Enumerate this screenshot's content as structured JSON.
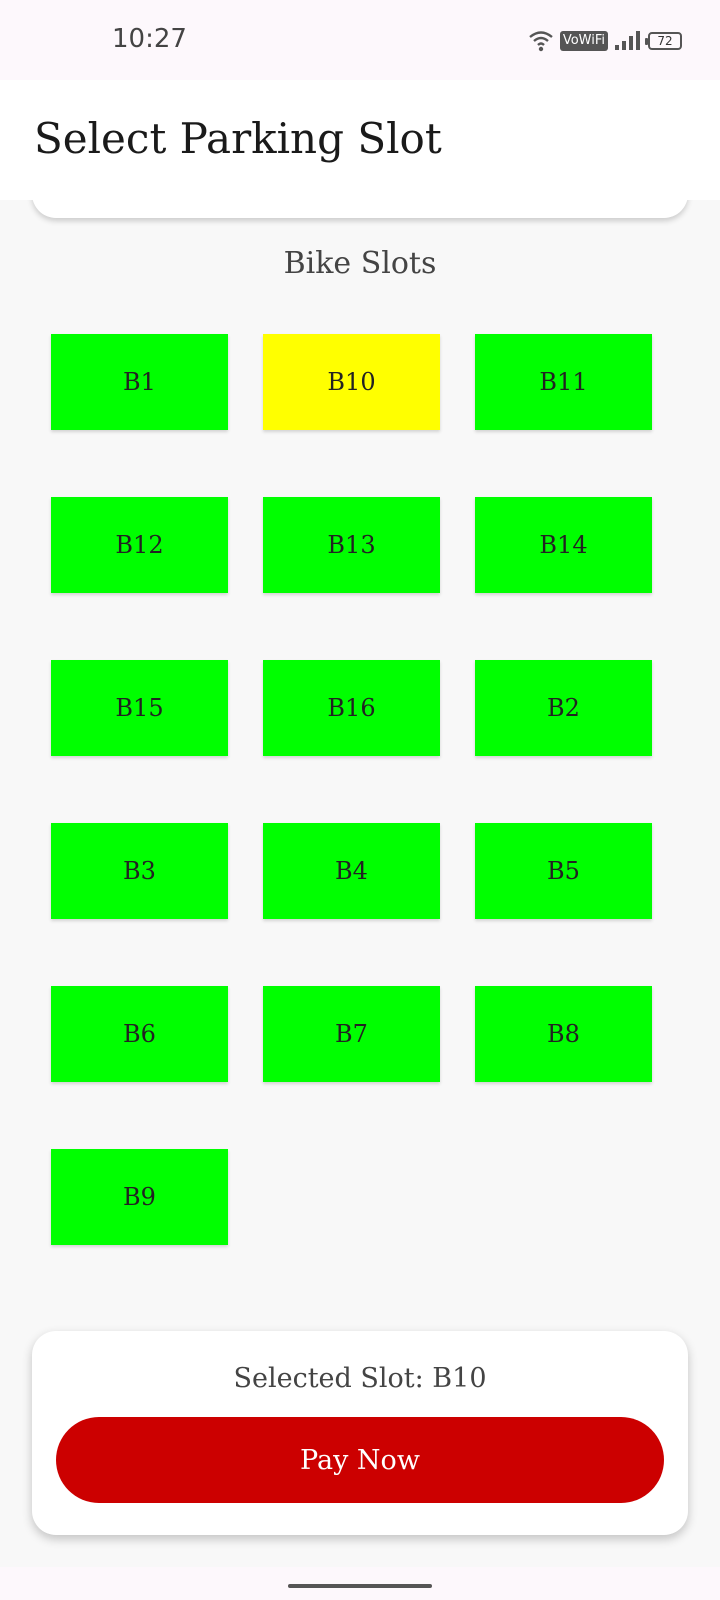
{
  "status_bar": {
    "time": "10:27",
    "wifi_icon": "wifi-icon",
    "vowifi_label": "VoWiFi",
    "signal_icon": "signal-icon",
    "battery_level": "72"
  },
  "header": {
    "title": "Select Parking Slot"
  },
  "section": {
    "title": "Bike Slots"
  },
  "colors": {
    "available": "#00ff00",
    "selected": "#ffff00",
    "pay_button": "#cc0000"
  },
  "slots": [
    {
      "label": "B1",
      "state": "available"
    },
    {
      "label": "B10",
      "state": "selected"
    },
    {
      "label": "B11",
      "state": "available"
    },
    {
      "label": "B12",
      "state": "available"
    },
    {
      "label": "B13",
      "state": "available"
    },
    {
      "label": "B14",
      "state": "available"
    },
    {
      "label": "B15",
      "state": "available"
    },
    {
      "label": "B16",
      "state": "available"
    },
    {
      "label": "B2",
      "state": "available"
    },
    {
      "label": "B3",
      "state": "available"
    },
    {
      "label": "B4",
      "state": "available"
    },
    {
      "label": "B5",
      "state": "available"
    },
    {
      "label": "B6",
      "state": "available"
    },
    {
      "label": "B7",
      "state": "available"
    },
    {
      "label": "B8",
      "state": "available"
    },
    {
      "label": "B9",
      "state": "available"
    }
  ],
  "footer": {
    "selected_text": "Selected Slot: B10",
    "pay_label": "Pay Now"
  }
}
